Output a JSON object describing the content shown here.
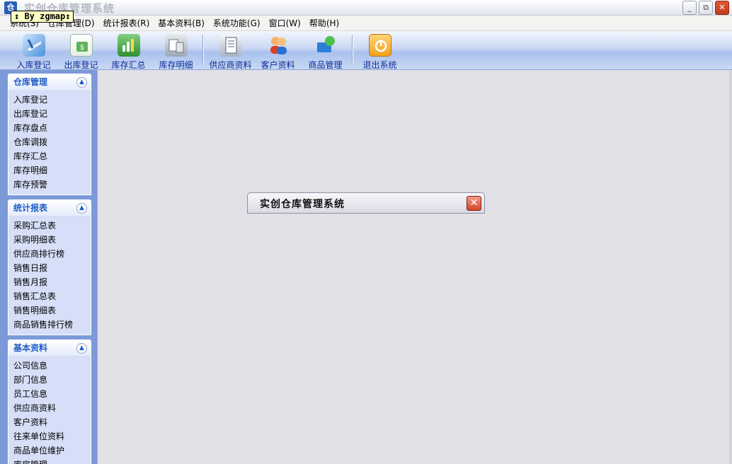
{
  "window": {
    "app_icon": "仓",
    "title": "实创仓库管理系统",
    "watermark": "↕ By zgmap↕",
    "buttons": {
      "minimize": "_",
      "restore": "⧉",
      "close": "✕"
    }
  },
  "menu": [
    {
      "label": "系统(S)"
    },
    {
      "label": "仓库管理(D)"
    },
    {
      "label": "统计报表(R)"
    },
    {
      "label": "基本资料(B)"
    },
    {
      "label": "系统功能(G)"
    },
    {
      "label": "窗口(W)"
    },
    {
      "label": "帮助(H)"
    }
  ],
  "toolbar": {
    "items": [
      {
        "label": "入库登记",
        "icon": "stock-in-icon",
        "color": "#4a90d9"
      },
      {
        "label": "出库登记",
        "icon": "stock-out-icon",
        "color": "#5fb35a"
      },
      {
        "label": "库存汇总",
        "icon": "inventory-summary-icon",
        "color": "#3fa33f"
      },
      {
        "label": "库存明细",
        "icon": "inventory-detail-icon",
        "color": "#8a9aa8"
      },
      {
        "label": "供应商资料",
        "icon": "supplier-icon",
        "color": "#6e7d94"
      },
      {
        "label": "客户资料",
        "icon": "customer-icon",
        "color": "#e07a2a"
      },
      {
        "label": "商品管理",
        "icon": "product-icon",
        "color": "#2a7fd4"
      },
      {
        "label": "退出系统",
        "icon": "power-icon",
        "color": "#f2a21a"
      }
    ]
  },
  "sidebar": {
    "panels": [
      {
        "title": "仓库管理",
        "items": [
          "入库登记",
          "出库登记",
          "库存盘点",
          "仓库调拨",
          "库存汇总",
          "库存明细",
          "库存预警"
        ]
      },
      {
        "title": "统计报表",
        "items": [
          "采购汇总表",
          "采购明细表",
          "供应商排行榜",
          "销售日报",
          "销售月报",
          "销售汇总表",
          "销售明细表",
          "商品销售排行榜"
        ]
      },
      {
        "title": "基本资料",
        "items": [
          "公司信息",
          "部门信息",
          "员工信息",
          "供应商资料",
          "客户资料",
          "往来单位资料",
          "商品单位维护",
          "库房管理"
        ]
      }
    ]
  },
  "dialog": {
    "title": "实创仓库管理系统",
    "close": "✕"
  },
  "colors": {
    "toolbar_label": "#0b2c93",
    "sidebar_bg": "#7c9ad8",
    "panel_title": "#215dc6",
    "workspace_bg": "#e1e1e6"
  }
}
